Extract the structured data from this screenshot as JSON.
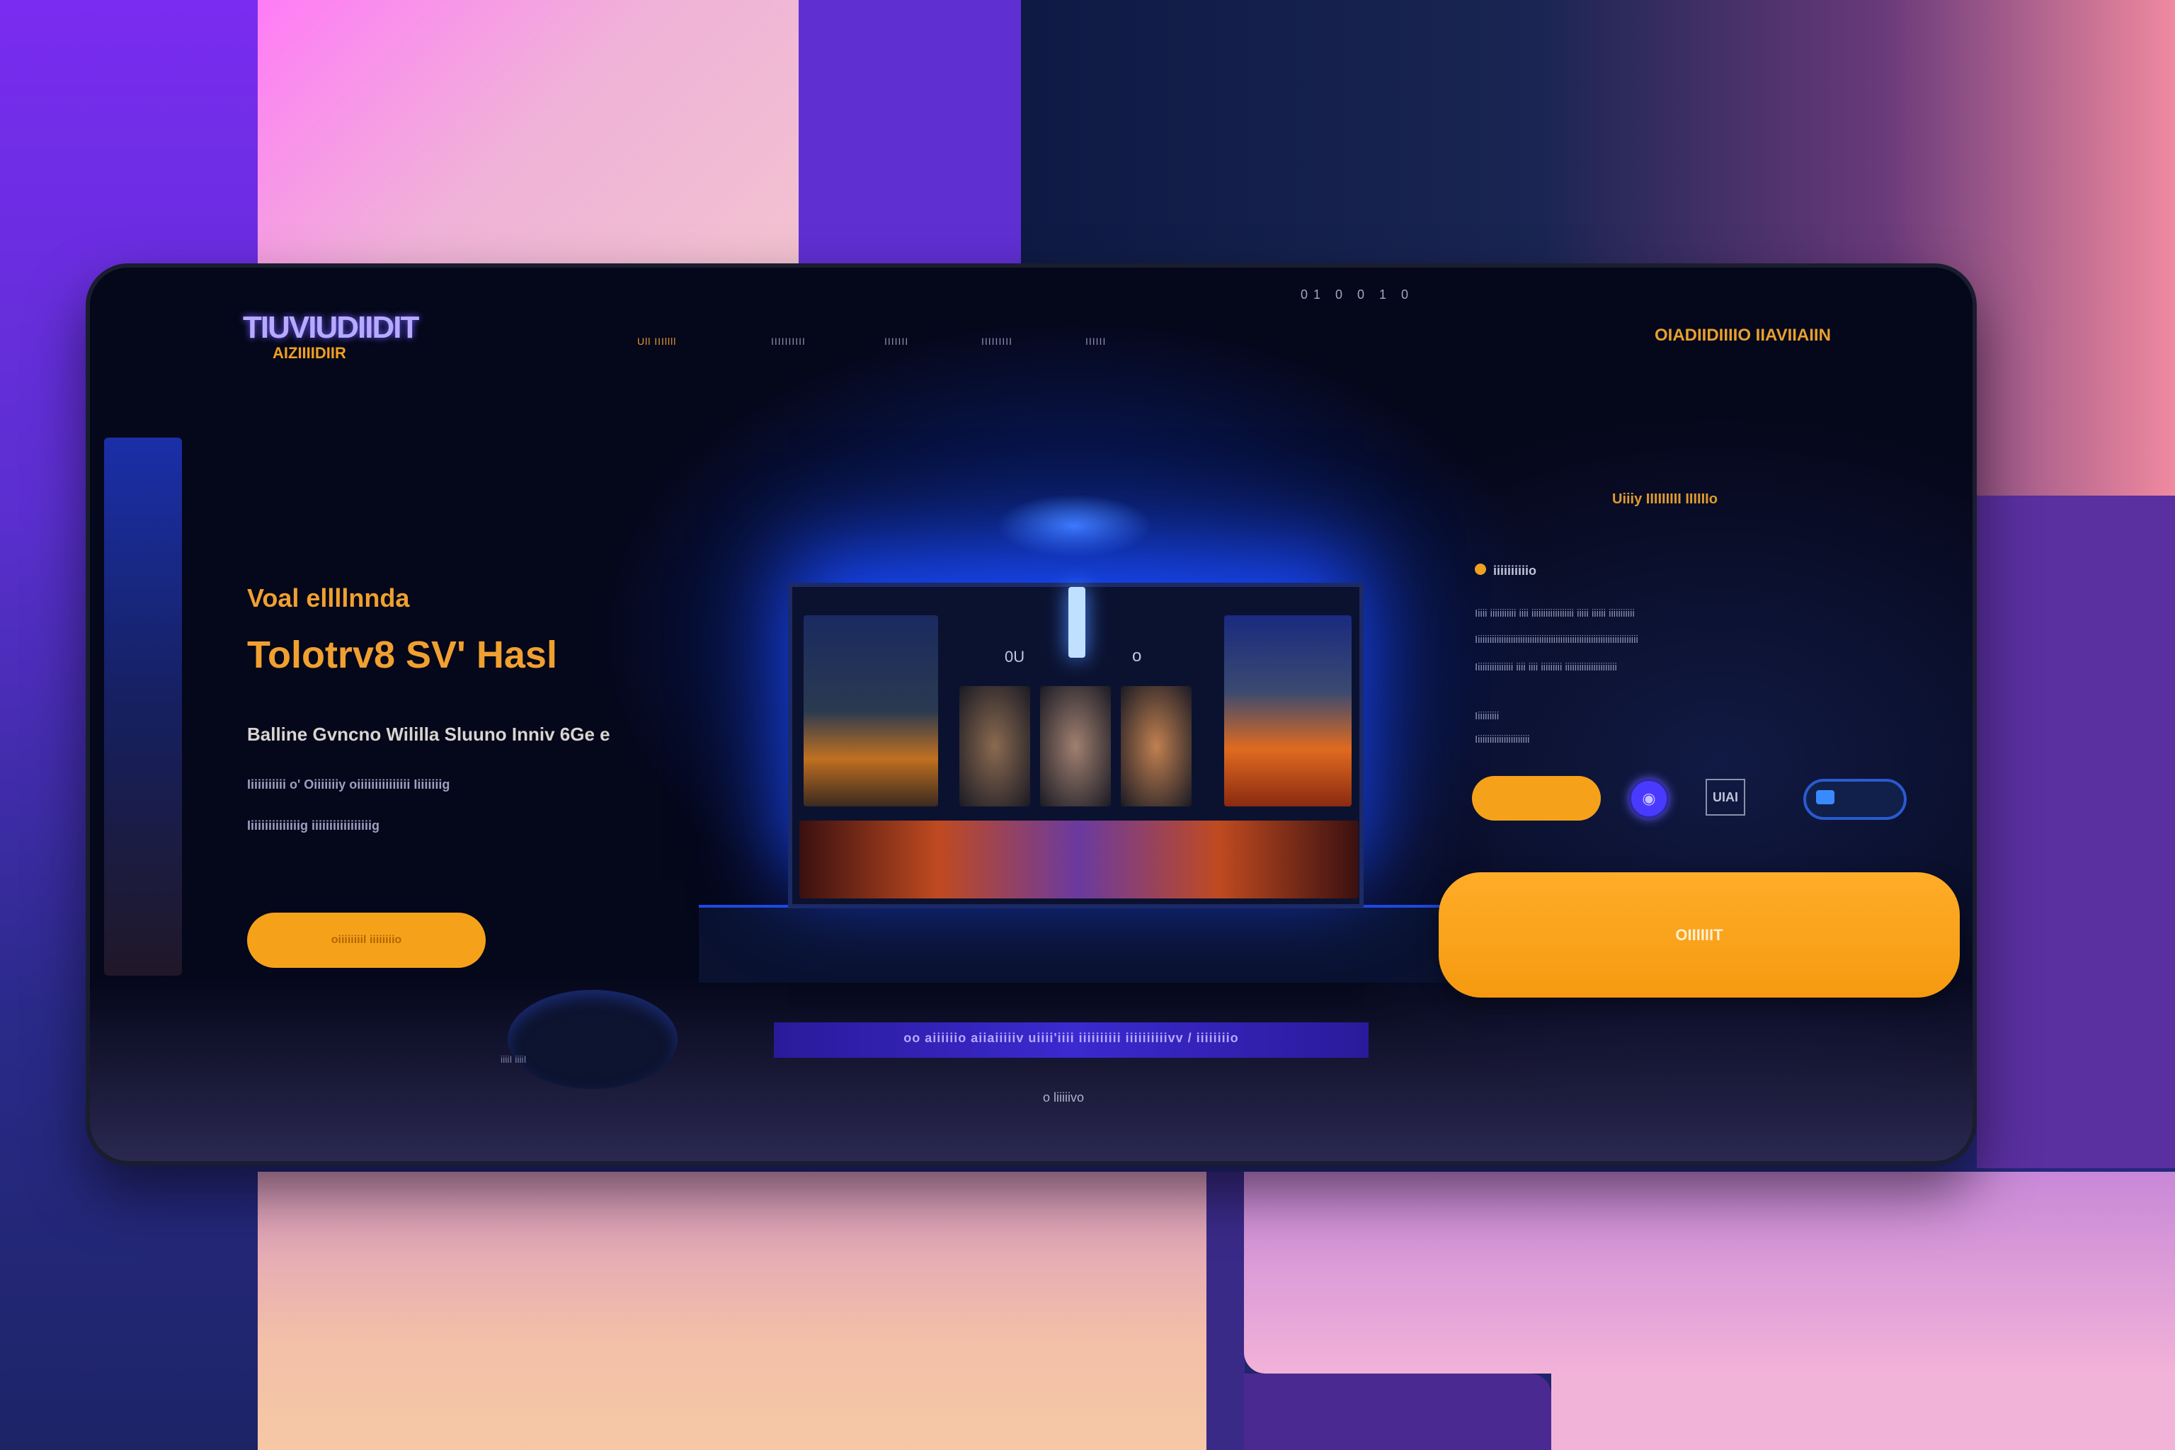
{
  "colors": {
    "accent": "#f5a21a",
    "glow": "#4a6aff",
    "background": "#05071a"
  },
  "header": {
    "logo_top": "TIUVIUDIIDIT",
    "logo_bottom": "AIZIIIIDIIR",
    "nav": [
      "Ull IIIllll",
      "IIIIIIIIII",
      "IIIIIII",
      "IIIIIIIII",
      "IIIIII"
    ],
    "top_label": "01 0 0 1 0",
    "top_right": "OIADIIDIIIIO IIAVIIAIIN"
  },
  "hero": {
    "line1": "Voal ellllnnda",
    "line2": "Tolotrv8 SV' Hasl",
    "subtitle": "Balline Gvncno Wililla Sluuno Inniv 6Ge e",
    "para": [
      "Iiiiiiiiiii o' Oiiiiiiiy oiiiiiiiiiiiiiii  Iiiiiiiig",
      "Iiiiiiiiiiiiiiig  iiiiiiiiiiiiiiiiig"
    ],
    "cta_label": "oiiiiiiiil  iiiiiiiio"
  },
  "monitor": {
    "icons": [
      "0U",
      "o"
    ]
  },
  "desk": {
    "keyboard_text": "oo aiiiiiio  aiiaiiiiiv  uiiii'iiii iiiiiiiiii  iiiiiiiiiivv  /  iiiiiiiio",
    "mouse_label": "iiiiI iiiiI",
    "bottom_label": "o  liiiiivo"
  },
  "right_panel": {
    "heading": "Uiiiy IIIIIIIII IIIIIIo",
    "item_label": "iiiiiiiiiio",
    "para": [
      "Iiiii iiiiiiiiiii iiii  iiiiiiiiiiiiiiiiii iiiii iiiiii  iiiiiiiiiii",
      "Iiiiiiiiiiiiiiiiiiiiiiiiiiiiiiiiiiiiiiiiiiiiiiiiiiiiiiiiiiiiiiiiiiiii",
      "Iiiiiiiiiiiiiiii  iiii  iiii iiiiiiiii iiiiiiiiiiiiiiiiiiiiii"
    ],
    "small": [
      "Iiiiiiiiii",
      "Iiiiiiiiiiiiiiiiiiiiiii"
    ],
    "icon_button_label": "UIAI",
    "primary_label": "OIIIIIIT"
  }
}
